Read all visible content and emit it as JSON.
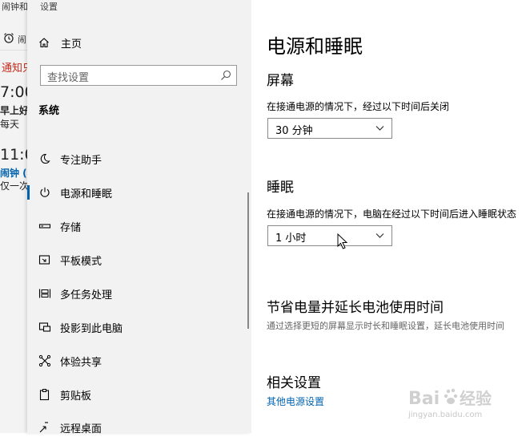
{
  "background_window": {
    "title": "闹钟和",
    "tab_label": "闹",
    "notice": "通知只",
    "alarms": [
      {
        "time": "7:00",
        "name": "早上好",
        "repeat": "每天"
      },
      {
        "time": "11:0",
        "name": "闹钟 (",
        "repeat": "仅一次"
      }
    ]
  },
  "nav": {
    "top_label": "设置",
    "home": "主页",
    "search_placeholder": "查找设置",
    "section": "系统",
    "items": [
      {
        "label": "专注助手",
        "icon": "moon-icon"
      },
      {
        "label": "电源和睡眠",
        "icon": "power-icon",
        "selected": true
      },
      {
        "label": "存储",
        "icon": "storage-icon"
      },
      {
        "label": "平板模式",
        "icon": "tablet-mode-icon"
      },
      {
        "label": "多任务处理",
        "icon": "multitasking-icon"
      },
      {
        "label": "投影到此电脑",
        "icon": "project-icon"
      },
      {
        "label": "体验共享",
        "icon": "shared-experiences-icon"
      },
      {
        "label": "剪贴板",
        "icon": "clipboard-icon"
      },
      {
        "label": "远程桌面",
        "icon": "remote-desktop-icon"
      }
    ]
  },
  "content": {
    "title": "电源和睡眠",
    "screen": {
      "heading": "屏幕",
      "desc": "在接通电源的情况下，经过以下时间后关闭",
      "value": "30 分钟"
    },
    "sleep": {
      "heading": "睡眠",
      "desc": "在接通电源的情况下，电脑在经过以下时间后进入睡眠状态",
      "value": "1 小时"
    },
    "battery": {
      "heading": "节省电量并延长电池使用时间",
      "desc": "通过选择更短的屏幕显示时长和睡眠设置，延长电池使用时间"
    },
    "related": {
      "heading": "相关设置",
      "link": "其他电源设置"
    }
  },
  "watermark": {
    "logo": "Baidu经验",
    "url": "jingyan.baidu.com"
  },
  "colors": {
    "accent": "#0063b1",
    "nav_bg": "#f2f2f2",
    "notice_red": "#c42b1c"
  }
}
